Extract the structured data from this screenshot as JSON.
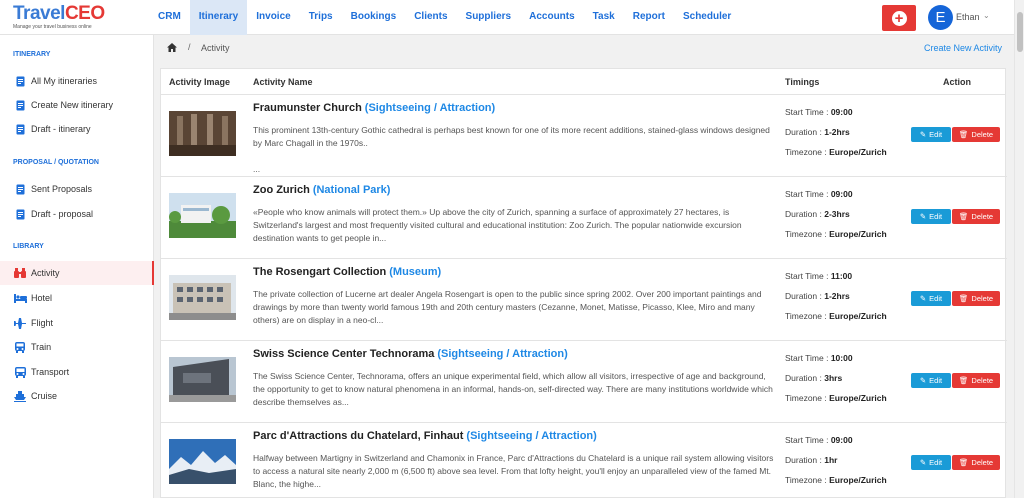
{
  "brand": {
    "name_part1": "Travel",
    "name_part2": "CEO",
    "tagline": "Manage your travel business online"
  },
  "nav": {
    "items": [
      "CRM",
      "Itinerary",
      "Invoice",
      "Trips",
      "Bookings",
      "Clients",
      "Suppliers",
      "Accounts",
      "Task",
      "Report",
      "Scheduler"
    ],
    "active": "Itinerary"
  },
  "user": {
    "initial": "E",
    "name": "Ethan"
  },
  "sidebar": {
    "sections": [
      {
        "title": "ITINERARY",
        "items": [
          "All My itineraries",
          "Create New itinerary",
          "Draft - itinerary"
        ]
      },
      {
        "title": "PROPOSAL / QUOTATION",
        "items": [
          "Sent Proposals",
          "Draft - proposal"
        ]
      },
      {
        "title": "LIBRARY",
        "items": [
          "Activity",
          "Hotel",
          "Flight",
          "Train",
          "Transport",
          "Cruise"
        ]
      }
    ],
    "active": "Activity"
  },
  "breadcrumb": {
    "current": "Activity"
  },
  "actions": {
    "create_new": "Create New Activity"
  },
  "table": {
    "headers": {
      "image": "Activity Image",
      "name": "Activity Name",
      "timings": "Timings",
      "action": "Action"
    },
    "labels": {
      "start": "Start Time : ",
      "duration": "Duration : ",
      "timezone": "Timezone : ",
      "edit": "Edit",
      "delete": "Delete"
    },
    "rows": [
      {
        "name": "Fraumunster Church",
        "category": "(Sightseeing / Attraction)",
        "description": "This prominent 13th-century Gothic cathedral is perhaps best known for one of its more recent additions, stained-glass windows designed by Marc Chagall in the 1970s..",
        "extra": "...",
        "start": "09:00",
        "duration": "1-2hrs",
        "timezone": "Europe/Zurich"
      },
      {
        "name": "Zoo Zurich",
        "category": "(National Park)",
        "description": "«People who know animals will protect them.» Up above the city of Zurich, spanning a surface of approximately 27 hectares, is Switzerland's largest and most frequently visited cultural and educational institution: Zoo Zurich. The popular nationwide excursion destination wants to get people in...",
        "extra": "",
        "start": "09:00",
        "duration": "2-3hrs",
        "timezone": "Europe/Zurich"
      },
      {
        "name": "The Rosengart Collection",
        "category": "(Museum)",
        "description": "The private collection of Lucerne art dealer Angela Rosengart is open to the public since spring 2002. Over 200 important paintings and drawings by more than twenty world famous 19th and 20th century masters (Cezanne, Monet, Matisse, Picasso, Klee, Miro and many others) are on display in a neo-cl...",
        "extra": "",
        "start": "11:00",
        "duration": "1-2hrs",
        "timezone": "Europe/Zurich"
      },
      {
        "name": "Swiss Science Center Technorama",
        "category": "(Sightseeing / Attraction)",
        "description": "The Swiss Science Center, Technorama, offers an unique experimental field, which allow all visitors, irrespective of age and background, the opportunity to get to know natural phenomena in an informal, hands-on, self-directed way. There are many institutions worldwide which describe themselves as...",
        "extra": "",
        "start": "10:00",
        "duration": "3hrs",
        "timezone": "Europe/Zurich"
      },
      {
        "name": "Parc d'Attractions du Chatelard, Finhaut",
        "category": "(Sightseeing / Attraction)",
        "description": "Halfway between Martigny in Switzerland and Chamonix in France, Parc d'Attractions du Chatelard is a unique rail system allowing visitors to access a natural site nearly 2,000 m (6,500 ft) above sea level. From that lofty height, you'll enjoy an unparalleled view of the famed Mt. Blanc, the highe...",
        "extra": "",
        "start": "09:00",
        "duration": "1hr",
        "timezone": "Europe/Zurich"
      }
    ]
  },
  "colors": {
    "accent": "#1e6fd9",
    "link": "#1e88e5",
    "danger": "#e53935",
    "edit": "#1a9bd7"
  }
}
